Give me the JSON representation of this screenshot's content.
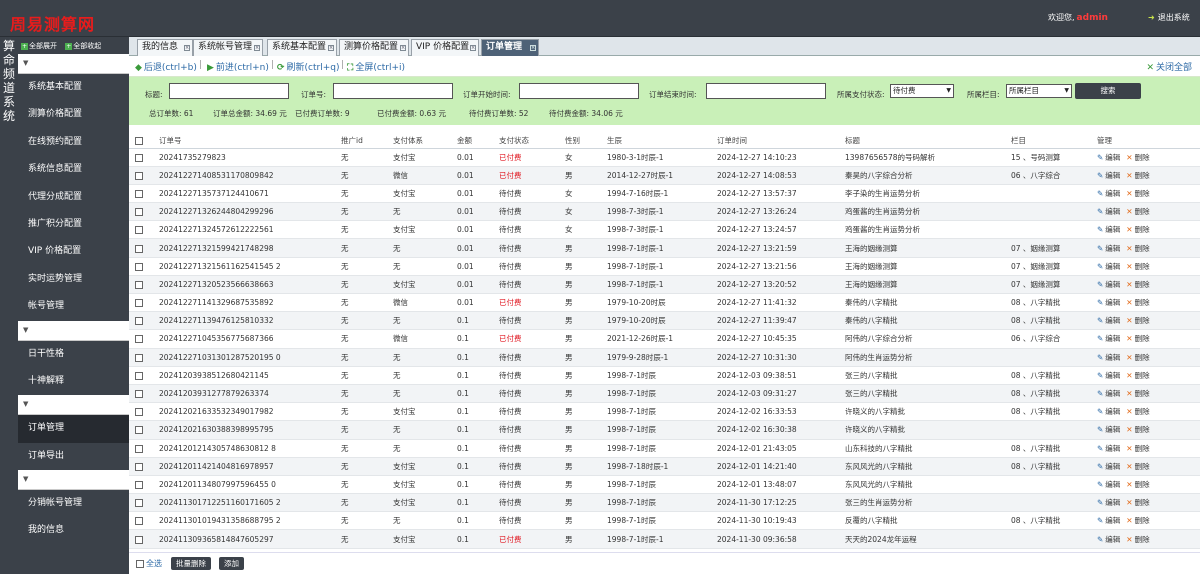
{
  "header": {
    "logo": "周易测算网",
    "welcome": "欢迎您,",
    "user": "admin",
    "logout": "退出系统"
  },
  "vertical_title": "算命频道系统",
  "sidebar": {
    "expand_all": "全部展开",
    "collapse_all": "全部收起",
    "group1": [
      "系统基本配置",
      "测算价格配置",
      "在线预约配置",
      "系统信息配置",
      "代理分成配置",
      "推广积分配置",
      "VIP 价格配置",
      "实时运势管理",
      "帐号管理"
    ],
    "group2": [
      "日干性格",
      "十神解释"
    ],
    "group3": [
      "订单管理",
      "订单导出"
    ],
    "group4": [
      "分销帐号管理",
      "我的信息"
    ]
  },
  "tabs": [
    {
      "label": "我的信息"
    },
    {
      "label": "系统帐号管理"
    },
    {
      "label": "系统基本配置"
    },
    {
      "label": "测算价格配置"
    },
    {
      "label": "VIP 价格配置"
    },
    {
      "label": "订单管理"
    }
  ],
  "toolbar": {
    "back": "后退(ctrl+b)",
    "forward": "前进(ctrl+n)",
    "refresh": "刷新(ctrl+q)",
    "fullscreen": "全屏(ctrl+i)",
    "close_all": "关闭全部"
  },
  "search": {
    "title_label": "标题:",
    "order_label": "订单号:",
    "start_label": "订单开始时间:",
    "end_label": "订单结束时间:",
    "status_label": "所属支付状态:",
    "status_value": "待付费",
    "column_label": "所属栏目:",
    "column_value": "所属栏目",
    "button": "搜索"
  },
  "stats": {
    "total_orders": "总订单数: 61",
    "total_amount": "订单总金额: 34.69 元",
    "paid_orders": "已付费订单数: 9",
    "paid_amount": "已付费金额: 0.63 元",
    "unpaid_orders": "待付费订单数: 52",
    "unpaid_amount": "待付费金额: 34.06 元"
  },
  "table": {
    "headers": [
      "订单号",
      "推广id",
      "支付体系",
      "金额",
      "支付状态",
      "性别",
      "生辰",
      "订单时间",
      "标题",
      "栏目",
      "管理"
    ],
    "edit": "编辑",
    "delete": "删除",
    "rows": [
      [
        "20241735279823",
        "无",
        "支付宝",
        "0.01",
        "已付费",
        "女",
        "1980-3-1时辰-1",
        "2024-12-27 14:10:23",
        "13987656578的号码解析",
        "15 、号码测算"
      ],
      [
        "202412271408531170809842",
        "无",
        "微信",
        "0.01",
        "已付费",
        "男",
        "2014-12-27时辰-1",
        "2024-12-27 14:08:53",
        "秦昊的八字综合分析",
        "06 、八字综合"
      ],
      [
        "20241227135737124410671",
        "无",
        "支付宝",
        "0.01",
        "待付费",
        "女",
        "1994-7-16时辰-1",
        "2024-12-27 13:57:37",
        "李子染的生肖运势分析",
        ""
      ],
      [
        "202412271326244804299296",
        "无",
        "无",
        "0.01",
        "待付费",
        "女",
        "1998-7-3时辰-1",
        "2024-12-27 13:26:24",
        "鸡蛋酱的生肖运势分析",
        ""
      ],
      [
        "202412271324572612222561",
        "无",
        "支付宝",
        "0.01",
        "待付费",
        "女",
        "1998-7-3时辰-1",
        "2024-12-27 13:24:57",
        "鸡蛋酱的生肖运势分析",
        ""
      ],
      [
        "202412271321599421748298",
        "无",
        "无",
        "0.01",
        "待付费",
        "男",
        "1998-7-1时辰-1",
        "2024-12-27 13:21:59",
        "王海的姻缘测算",
        "07 、姻缘测算"
      ],
      [
        "202412271321561162541545 2",
        "无",
        "无",
        "0.01",
        "待付费",
        "男",
        "1998-7-1时辰-1",
        "2024-12-27 13:21:56",
        "王海的姻缘测算",
        "07 、姻缘测算"
      ],
      [
        "202412271320523566638663",
        "无",
        "支付宝",
        "0.01",
        "待付费",
        "男",
        "1998-7-1时辰-1",
        "2024-12-27 13:20:52",
        "王海的姻缘测算",
        "07 、姻缘测算"
      ],
      [
        "202412271141329687535892",
        "无",
        "微信",
        "0.01",
        "已付费",
        "男",
        "1979-10-20时辰",
        "2024-12-27 11:41:32",
        "秦伟的八字精批",
        "08 、八字精批"
      ],
      [
        "202412271139476125810332",
        "无",
        "无",
        "0.1",
        "待付费",
        "男",
        "1979-10-20时辰",
        "2024-12-27 11:39:47",
        "秦伟的八字精批",
        "08 、八字精批"
      ],
      [
        "202412271045356775687366",
        "无",
        "微信",
        "0.1",
        "已付费",
        "男",
        "2021-12-26时辰-1",
        "2024-12-27 10:45:35",
        "阿伟的八字综合分析",
        "06 、八字综合"
      ],
      [
        "202412271031301287520195 0",
        "无",
        "无",
        "0.1",
        "待付费",
        "男",
        "1979-9-28时辰-1",
        "2024-12-27 10:31:30",
        "阿伟的生肖运势分析",
        ""
      ],
      [
        "20241203938512680421145",
        "无",
        "无",
        "0.1",
        "待付费",
        "男",
        "1998-7-1时辰",
        "2024-12-03 09:38:51",
        "张三的八字精批",
        "08 、八字精批"
      ],
      [
        "20241203931277879263374",
        "无",
        "无",
        "0.1",
        "待付费",
        "男",
        "1998-7-1时辰",
        "2024-12-03 09:31:27",
        "张三的八字精批",
        "08 、八字精批"
      ],
      [
        "202412021633532349017982",
        "无",
        "支付宝",
        "0.1",
        "待付费",
        "男",
        "1998-7-1时辰",
        "2024-12-02 16:33:53",
        "许晓义的八字精批",
        "08 、八字精批"
      ],
      [
        "202412021630388398995795",
        "无",
        "无",
        "0.1",
        "待付费",
        "男",
        "1998-7-1时辰",
        "2024-12-02 16:30:38",
        "许晓义的八字精批",
        ""
      ],
      [
        "20241201214305748630812 8",
        "无",
        "无",
        "0.1",
        "待付费",
        "男",
        "1998-7-1时辰",
        "2024-12-01 21:43:05",
        "山东科技的八字精批",
        "08 、八字精批"
      ],
      [
        "202412011421404816978957",
        "无",
        "支付宝",
        "0.1",
        "待付费",
        "男",
        "1998-7-18时辰-1",
        "2024-12-01 14:21:40",
        "东风风光的八字精批",
        "08 、八字精批"
      ],
      [
        "20241201134807997596455 0",
        "无",
        "支付宝",
        "0.1",
        "待付费",
        "男",
        "1998-7-1时辰",
        "2024-12-01 13:48:07",
        "东风风光的八字精批",
        ""
      ],
      [
        "202411301712251160171605 2",
        "无",
        "支付宝",
        "0.1",
        "待付费",
        "男",
        "1998-7-1时辰",
        "2024-11-30 17:12:25",
        "张三的生肖运势分析",
        ""
      ],
      [
        "202411301019431358688795 2",
        "无",
        "无",
        "0.1",
        "待付费",
        "男",
        "1998-7-1时辰",
        "2024-11-30 10:19:43",
        "反覆的八字精批",
        "08 、八字精批"
      ],
      [
        "202411309365814847605297",
        "无",
        "支付宝",
        "0.1",
        "已付费",
        "男",
        "1998-7-1时辰-1",
        "2024-11-30 09:36:58",
        "天天的2024龙年运程",
        ""
      ]
    ]
  },
  "bottom": {
    "select_all": "全选",
    "batch_delete": "批量删除",
    "add": "添加"
  },
  "colors": {
    "header_bg": "#3b4149",
    "search_bg": "#c9f0b8",
    "unpaid_red": "#e0141e",
    "active_tab": "#4e6277"
  }
}
